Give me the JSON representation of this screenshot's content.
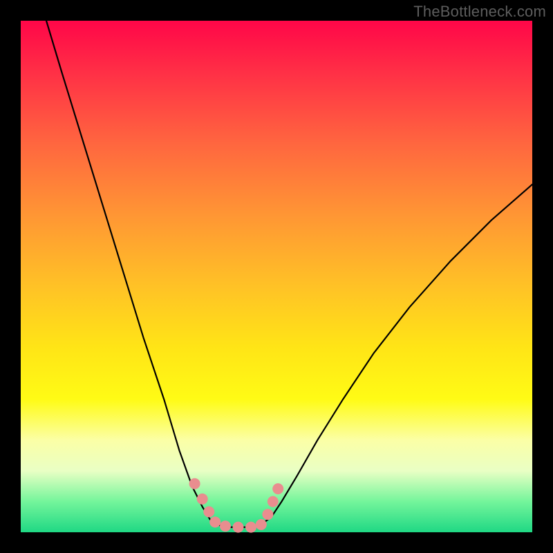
{
  "watermark": "TheBottleneck.com",
  "chart_data": {
    "type": "line",
    "title": "",
    "xlabel": "",
    "ylabel": "",
    "xlim": [
      0,
      100
    ],
    "ylim": [
      0,
      100
    ],
    "grid": false,
    "legend": false,
    "series": [
      {
        "name": "left-branch",
        "x": [
          5,
          8,
          12,
          16,
          20,
          24,
          28,
          31,
          33.5,
          35.5,
          37,
          38
        ],
        "values": [
          100,
          90,
          77,
          64,
          51,
          38,
          26,
          16,
          9,
          5,
          2.5,
          1.5
        ]
      },
      {
        "name": "right-branch",
        "x": [
          47,
          49,
          51,
          54,
          58,
          63,
          69,
          76,
          84,
          92,
          100
        ],
        "values": [
          1.5,
          3,
          6,
          11,
          18,
          26,
          35,
          44,
          53,
          61,
          68
        ]
      },
      {
        "name": "valley-floor",
        "x": [
          38,
          41,
          44,
          47
        ],
        "values": [
          1.5,
          1,
          1,
          1.5
        ]
      }
    ],
    "markers": {
      "name": "pink-dots",
      "color": "#e98d8f",
      "points": [
        {
          "x": 34.0,
          "y": 9.5
        },
        {
          "x": 35.5,
          "y": 6.5
        },
        {
          "x": 36.8,
          "y": 4.0
        },
        {
          "x": 38.0,
          "y": 2.0
        },
        {
          "x": 40.0,
          "y": 1.2
        },
        {
          "x": 42.5,
          "y": 1.0
        },
        {
          "x": 45.0,
          "y": 1.0
        },
        {
          "x": 47.0,
          "y": 1.5
        },
        {
          "x": 48.3,
          "y": 3.5
        },
        {
          "x": 49.3,
          "y": 6.0
        },
        {
          "x": 50.3,
          "y": 8.5
        }
      ]
    },
    "background_gradient": {
      "stops": [
        {
          "pos": 0,
          "color": "#ff0648"
        },
        {
          "pos": 24,
          "color": "#ff663f"
        },
        {
          "pos": 52,
          "color": "#ffc226"
        },
        {
          "pos": 74,
          "color": "#fffb15"
        },
        {
          "pos": 88,
          "color": "#e9ffc4"
        },
        {
          "pos": 100,
          "color": "#1fd884"
        }
      ]
    }
  }
}
